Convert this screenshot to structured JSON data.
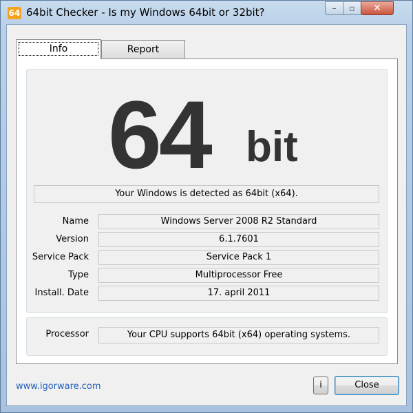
{
  "window": {
    "icon_text": "64",
    "title": "64bit Checker - Is my Windows 64bit or 32bit?",
    "minimize_glyph": "–",
    "maximize_glyph": "▫",
    "close_glyph": "✕"
  },
  "tabs": [
    {
      "label": "Info",
      "selected": true
    },
    {
      "label": "Report",
      "selected": false
    }
  ],
  "result": {
    "number": "64",
    "unit": "bit",
    "message": "Your Windows is detected as 64bit (x64)."
  },
  "details": [
    {
      "label": "Name",
      "value": "Windows Server 2008 R2 Standard"
    },
    {
      "label": "Version",
      "value": "6.1.7601"
    },
    {
      "label": "Service Pack",
      "value": "Service Pack 1"
    },
    {
      "label": "Type",
      "value": "Multiprocessor Free"
    },
    {
      "label": "Install. Date",
      "value": "17. april 2011"
    }
  ],
  "processor": {
    "label": "Processor",
    "value": "Your CPU supports 64bit (x64) operating systems."
  },
  "footer": {
    "link": "www.igorware.com",
    "info_button": "i",
    "close_button": "Close"
  }
}
